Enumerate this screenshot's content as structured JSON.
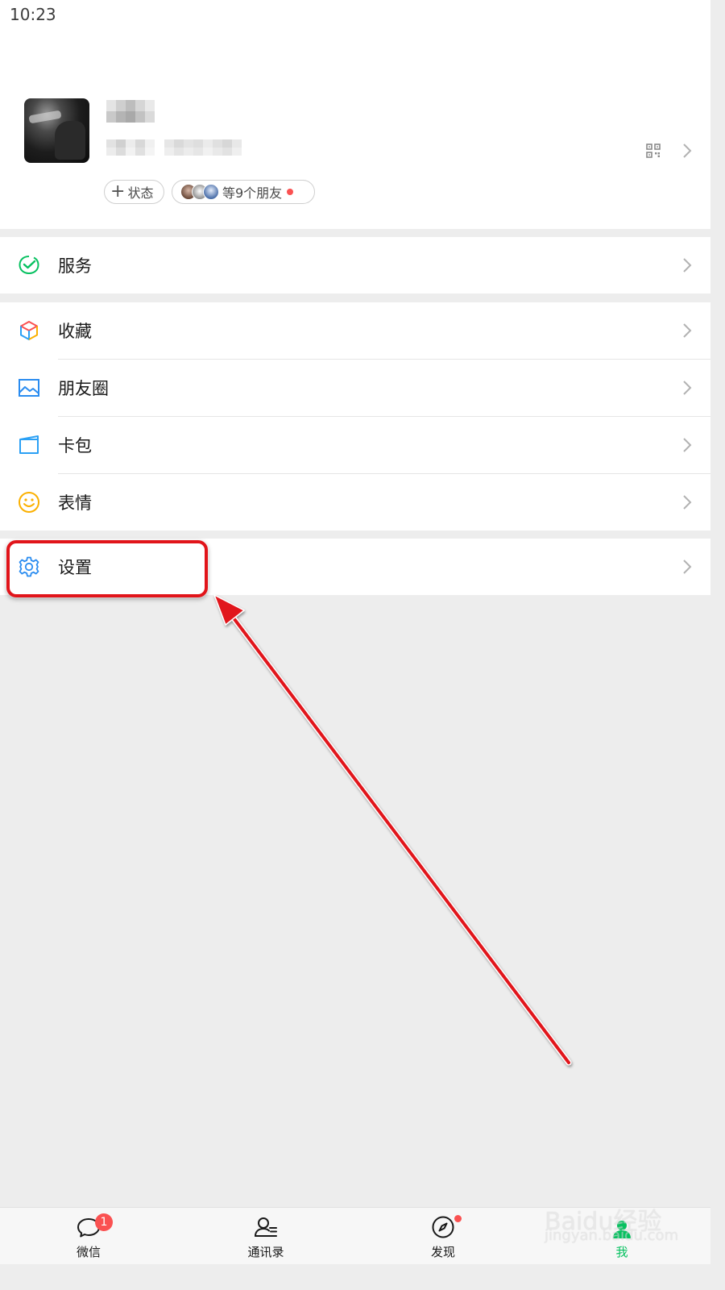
{
  "status_bar": {
    "time": "10:23"
  },
  "profile": {
    "chip_status": {
      "plus": "+",
      "label": "状态"
    },
    "chip_friends": {
      "label": "等9个朋友"
    }
  },
  "menu": {
    "service": "服务",
    "favorites": "收藏",
    "moments": "朋友圈",
    "cards": "卡包",
    "stickers": "表情",
    "settings": "设置"
  },
  "tabbar": {
    "tabs": [
      {
        "label": "微信",
        "badge": "1"
      },
      {
        "label": "通讯录"
      },
      {
        "label": "发现"
      },
      {
        "label": "我"
      }
    ],
    "active": "我"
  },
  "watermark": {
    "main": "Baidu经验",
    "sub": "jingyan.baidu.com"
  },
  "colors": {
    "accent": "#07c160",
    "badge": "#fa5151",
    "annotation": "#e1141a"
  }
}
